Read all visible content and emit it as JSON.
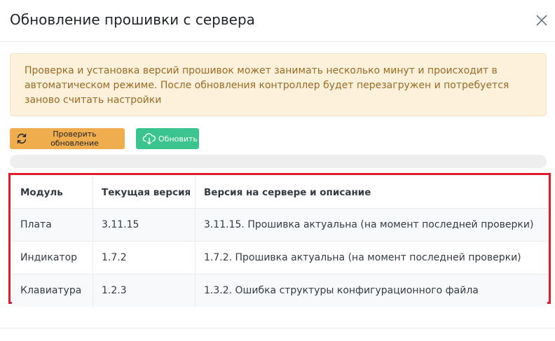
{
  "modal": {
    "title": "Обновление прошивки с сервера"
  },
  "alert": {
    "text": "Проверка и установка версий прошивок может занимать несколько минут и происходит в автоматическом режиме. После обновления контроллер будет перезагружен и потребуется заново считать настройки"
  },
  "buttons": {
    "check_label": "Проверить обновление",
    "update_label": "Обновить"
  },
  "progress": {
    "value": 0
  },
  "table": {
    "headers": [
      "Модуль",
      "Текущая версия",
      "Версия на сервере и описание"
    ],
    "rows": [
      [
        "Плата",
        "3.11.15",
        "3.11.15. Прошивка актуальна (на момент последней проверки)"
      ],
      [
        "Индикатор",
        "1.7.2",
        "1.7.2. Прошивка актуальна (на момент последней проверки)"
      ],
      [
        "Клавиатура",
        "1.2.3",
        "1.3.2. Ошибка структуры конфигурационного файла"
      ]
    ]
  },
  "colors": {
    "warning": "#f0ad4e",
    "success": "#3cc48e",
    "highlight_border": "#e11b2a",
    "alert_bg": "#fdf1dc",
    "alert_text": "#9a6a23"
  },
  "icons": {
    "close": "close-icon",
    "check": "refresh-icon",
    "update": "cloud-download-icon"
  }
}
